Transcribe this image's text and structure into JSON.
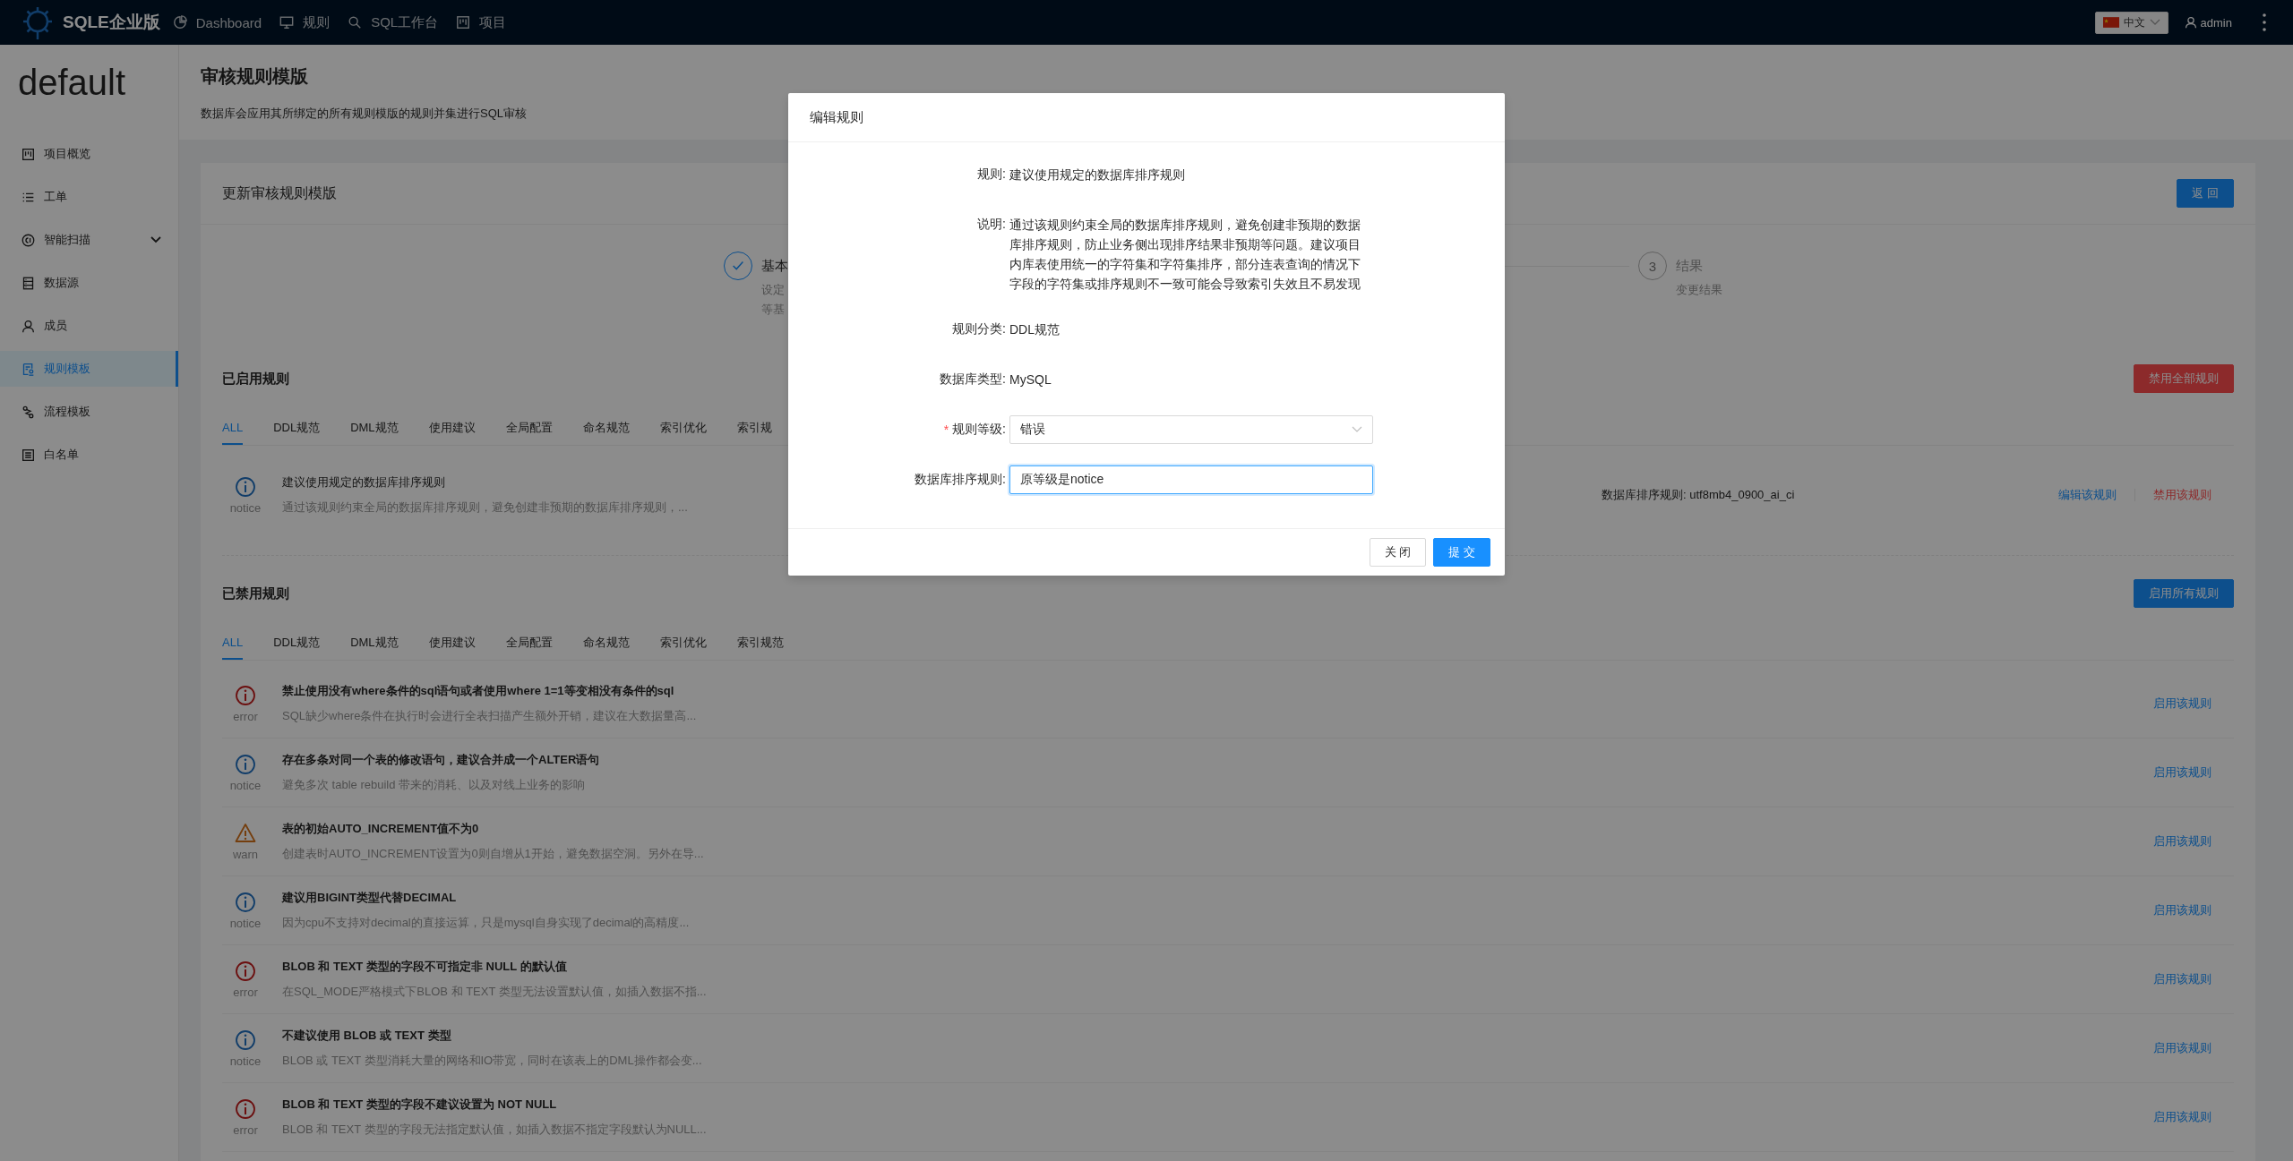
{
  "topbar": {
    "brand": "SQLE企业版",
    "nav": [
      {
        "label": "Dashboard"
      },
      {
        "label": "规则"
      },
      {
        "label": "SQL工作台"
      },
      {
        "label": "项目"
      }
    ],
    "language": {
      "label": "中文"
    },
    "user": {
      "label": "admin"
    }
  },
  "sidebar": {
    "project": "default",
    "items": [
      {
        "label": "项目概览",
        "selected": false,
        "expandable": false
      },
      {
        "label": "工单",
        "selected": false,
        "expandable": false
      },
      {
        "label": "智能扫描",
        "selected": false,
        "expandable": true
      },
      {
        "label": "数据源",
        "selected": false,
        "expandable": false
      },
      {
        "label": "成员",
        "selected": false,
        "expandable": false
      },
      {
        "label": "规则模板",
        "selected": true,
        "expandable": false
      },
      {
        "label": "流程模板",
        "selected": false,
        "expandable": false
      },
      {
        "label": "白名单",
        "selected": false,
        "expandable": false
      }
    ]
  },
  "page_header": {
    "title": "审核规则模版",
    "description": "数据库会应用其所绑定的所有规则模版的规则并集进行SQL审核"
  },
  "card": {
    "title": "更新审核规则模版",
    "back_button": "返 回",
    "steps": [
      {
        "kind": "done",
        "title": "基本",
        "description": [
          "设定",
          "等基"
        ]
      },
      {
        "kind": "wait",
        "number": "3",
        "title": "结果",
        "description": [
          "变更结果"
        ]
      }
    ]
  },
  "enabled_rules": {
    "title": "已启用规则",
    "action_button": "禁用全部规则",
    "tabs": [
      {
        "label": "ALL",
        "selected": true
      },
      {
        "label": "DDL规范",
        "selected": false
      },
      {
        "label": "DML规范",
        "selected": false
      },
      {
        "label": "使用建议",
        "selected": false
      },
      {
        "label": "全局配置",
        "selected": false
      },
      {
        "label": "命名规范",
        "selected": false
      },
      {
        "label": "索引优化",
        "selected": false
      },
      {
        "label": "索引规",
        "selected": false
      }
    ],
    "rules": [
      {
        "kind": "notice",
        "level_text": "notice",
        "title": "建议使用规定的数据库排序规则",
        "description": "通过该规则约束全局的数据库排序规则，避免创建非预期的数据库排序规则，...",
        "config": "数据库排序规则: utf8mb4_0900_ai_ci",
        "actions": [
          {
            "label": "编辑该规则",
            "kind": "edit"
          },
          {
            "label": "禁用该规则",
            "kind": "disable"
          }
        ]
      }
    ]
  },
  "disabled_rules": {
    "title": "已禁用规则",
    "action_button": "启用所有规则",
    "tabs": [
      {
        "label": "ALL",
        "selected": true
      },
      {
        "label": "DDL规范",
        "selected": false
      },
      {
        "label": "DML规范",
        "selected": false
      },
      {
        "label": "使用建议",
        "selected": false
      },
      {
        "label": "全局配置",
        "selected": false
      },
      {
        "label": "命名规范",
        "selected": false
      },
      {
        "label": "索引优化",
        "selected": false
      },
      {
        "label": "索引规范",
        "selected": false
      }
    ],
    "rules": [
      {
        "kind": "error",
        "level_text": "error",
        "title": "禁止使用没有where条件的sql语句或者使用where 1=1等变相没有条件的sql",
        "description": "SQL缺少where条件在执行时会进行全表扫描产生额外开销，建议在大数据量高...",
        "actions": [
          {
            "label": "启用该规则",
            "kind": "enable"
          }
        ]
      },
      {
        "kind": "notice",
        "level_text": "notice",
        "title": "存在多条对同一个表的修改语句，建议合并成一个ALTER语句",
        "description": "避免多次 table rebuild 带来的消耗、以及对线上业务的影响",
        "actions": [
          {
            "label": "启用该规则",
            "kind": "enable"
          }
        ]
      },
      {
        "kind": "warn",
        "level_text": "warn",
        "title": "表的初始AUTO_INCREMENT值不为0",
        "description": "创建表时AUTO_INCREMENT设置为0则自增从1开始，避免数据空洞。另外在导...",
        "actions": [
          {
            "label": "启用该规则",
            "kind": "enable"
          }
        ]
      },
      {
        "kind": "notice",
        "level_text": "notice",
        "title": "建议用BIGINT类型代替DECIMAL",
        "description": "因为cpu不支持对decimal的直接运算，只是mysql自身实现了decimal的高精度...",
        "actions": [
          {
            "label": "启用该规则",
            "kind": "enable"
          }
        ]
      },
      {
        "kind": "error",
        "level_text": "error",
        "title": "BLOB 和 TEXT 类型的字段不可指定非 NULL 的默认值",
        "description": "在SQL_MODE严格模式下BLOB 和 TEXT 类型无法设置默认值，如插入数据不指...",
        "actions": [
          {
            "label": "启用该规则",
            "kind": "enable"
          }
        ]
      },
      {
        "kind": "notice",
        "level_text": "notice",
        "title": "不建议使用 BLOB 或 TEXT 类型",
        "description": "BLOB 或 TEXT 类型消耗大量的网络和IO带宽，同时在该表上的DML操作都会变...",
        "actions": [
          {
            "label": "启用该规则",
            "kind": "enable"
          }
        ]
      },
      {
        "kind": "error",
        "level_text": "error",
        "title": "BLOB 和 TEXT 类型的字段不建议设置为 NOT NULL",
        "description": "BLOB 和 TEXT 类型的字段无法指定默认值，如插入数据不指定字段默认为NULL...",
        "actions": [
          {
            "label": "启用该规则",
            "kind": "enable"
          }
        ]
      }
    ]
  },
  "modal": {
    "title": "编辑规则",
    "fields": [
      {
        "kind": "text",
        "label": "规则:",
        "value": "建议使用规定的数据库排序规则"
      },
      {
        "kind": "text",
        "label": "说明:",
        "value": "通过该规则约束全局的数据库排序规则，避免创建非预期的数据库排序规则，防止业务侧出现排序结果非预期等问题。建议项目内库表使用统一的字符集和字符集排序，部分连表查询的情况下字段的字符集或排序规则不一致可能会导致索引失效且不易发现"
      },
      {
        "kind": "text",
        "label": "规则分类:",
        "value": "DDL规范"
      },
      {
        "kind": "text",
        "label": "数据库类型:",
        "value": "MySQL"
      },
      {
        "kind": "select",
        "label": "规则等级:",
        "required": true,
        "required_mark": "*",
        "value": "错误"
      },
      {
        "kind": "input",
        "label": "数据库排序规则:",
        "value": "原等级是notice",
        "focused": true
      }
    ],
    "buttons": [
      {
        "label": "关 闭",
        "kind": "default"
      },
      {
        "label": "提 交",
        "kind": "primary"
      }
    ]
  }
}
